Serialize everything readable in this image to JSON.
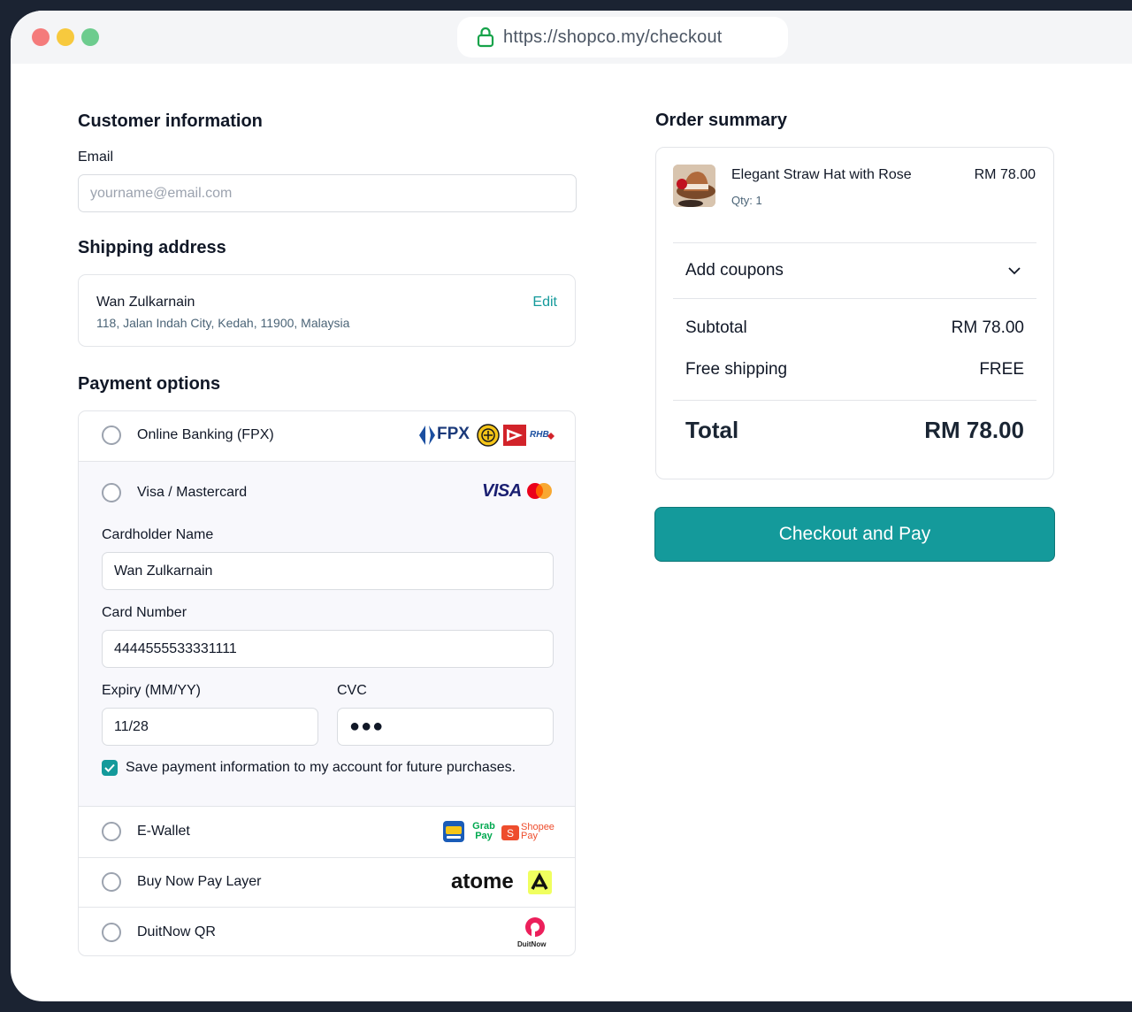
{
  "browser": {
    "url": "https://shopco.my/checkout"
  },
  "customer": {
    "title": "Customer information",
    "email_label": "Email",
    "email_placeholder": "yourname@email.com"
  },
  "shipping": {
    "title": "Shipping address",
    "name": "Wan Zulkarnain",
    "address": "118, Jalan Indah City, Kedah, 11900, Malaysia",
    "edit_label": "Edit"
  },
  "payment": {
    "title": "Payment options",
    "options": [
      {
        "label": "Online Banking (FPX)",
        "logo_text": "FPX",
        "logo_text_2": "RHB"
      },
      {
        "label": "Visa / Mastercard",
        "logo_text": "VISA"
      },
      {
        "label": "E-Wallet",
        "logo_text": "Grab Pay",
        "logo_text_2": "Shopee Pay"
      },
      {
        "label": "Buy Now Pay Layer",
        "logo_text": "atome"
      },
      {
        "label": "DuitNow QR",
        "logo_text": "DuitNow"
      }
    ],
    "card": {
      "holder_label": "Cardholder Name",
      "holder_value": "Wan Zulkarnain",
      "number_label": "Card Number",
      "number_value": "4444555533331111",
      "expiry_label": "Expiry (MM/YY)",
      "expiry_value": "11/28",
      "cvc_label": "CVC",
      "cvc_value": "●●●",
      "save_text": "Save payment information to my account for future purchases.",
      "save_checked": true
    }
  },
  "summary": {
    "title": "Order summary",
    "product": {
      "name": "Elegant Straw Hat with Rose",
      "qty": "Qty: 1",
      "price": "RM 78.00"
    },
    "coupon_label": "Add coupons",
    "subtotal_label": "Subtotal",
    "subtotal_value": "RM 78.00",
    "shipping_label": "Free shipping",
    "shipping_value": "FREE",
    "total_label": "Total",
    "total_value": "RM 78.00"
  },
  "checkout_button": "Checkout and Pay",
  "colors": {
    "accent": "#149a9b",
    "frame": "#1b2332"
  }
}
